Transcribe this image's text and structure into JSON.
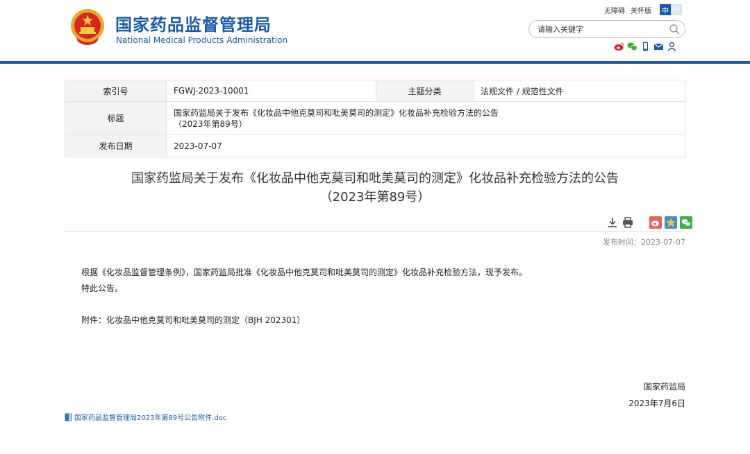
{
  "header": {
    "title_cn": "国家药品监督管理局",
    "title_en": "National Medical Products Administration",
    "links": {
      "accessibility": "无障碍",
      "elderly": "关怀版"
    },
    "lang": {
      "zh": "中",
      "en": "En"
    },
    "search": {
      "placeholder": "请输入关键字"
    },
    "colors": {
      "brand": "#1a5aa6"
    }
  },
  "meta": {
    "index_label": "索引号",
    "index_value": "FGWJ-2023-10001",
    "category_label": "主题分类",
    "category_value": "法规文件 / 规范性文件",
    "title_label": "标题",
    "title_value_line1": "国家药监局关于发布《化妆品中他克莫司和吡美莫司的测定》化妆品补充检验方法的公告",
    "title_value_line2": "（2023年第89号）",
    "date_label": "发布日期",
    "date_value": "2023-07-07"
  },
  "article": {
    "title_line1": "国家药监局关于发布《化妆品中他克莫司和吡美莫司的测定》化妆品补充检验方法的公告",
    "title_line2": "（2023年第89号）",
    "publish_time": "发布时间：2023-07-07",
    "paragraph1": "根据《化妆品监督管理条例》，国家药监局批准《化妆品中他克莫司和吡美莫司的测定》化妆品补充检验方法，现予发布。",
    "paragraph2": "特此公告。",
    "attachment": "附件：化妆品中他克莫司和吡美莫司的测定（BJH 202301）",
    "signer": "国家药监局",
    "sign_date": "2023年7月6日",
    "file_link": "国家药品监督管理局2023年第89号公告附件.doc"
  }
}
